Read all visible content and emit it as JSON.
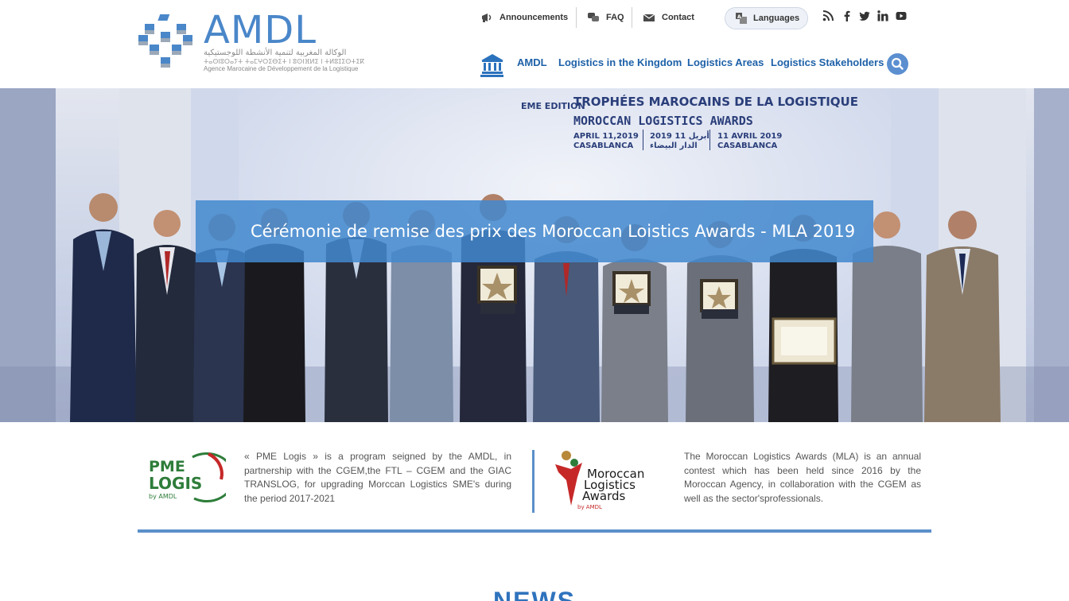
{
  "logo": {
    "text": "AMDL",
    "arabic": "الوكالة المغربية لتنمية الأنشطة اللوجستيكية",
    "tifinagh": "ⵜⴰⵙⵏⵓⵔⴰⵢⵜ ⵜⴰⵎⵖⵔⵉⴱⵉⵜ ⵏ ⵓⵙⵏⴼⵍⵉ ⵏ ⵜⵍⵓⵊⵉⵙⵜⵉⴽ",
    "french": "Agence Marocaine de Développement de la Logistique"
  },
  "util": {
    "announcements": "Announcements",
    "faq": "FAQ",
    "contact": "Contact",
    "languages": "Languages"
  },
  "social": [
    "rss-icon",
    "facebook-icon",
    "twitter-icon",
    "linkedin-icon",
    "youtube-icon"
  ],
  "nav": {
    "items": [
      "AMDL",
      "Logistics in the Kingdom",
      "Logistics Areas",
      "Logistics Stakeholders"
    ]
  },
  "hero": {
    "caption": "Cérémonie de remise des prix des Moroccan Loistics Awards - MLA 2019",
    "banner_edition": "EME EDITION",
    "banner_line1": "TROPHÉES MAROCAINS DE LA LOGISTIQUE",
    "banner_line2": "MOROCCAN LOGISTICS AWARDS",
    "banner_date_left": "APRIL 11,2019",
    "banner_city_left": "CASABLANCA",
    "banner_date_mid": "2019 11 أبريل",
    "banner_city_mid": "الدار البيضاء",
    "banner_date_right": "11 AVRIL 2019",
    "banner_city_right": "CASABLANCA"
  },
  "programs": {
    "pme": {
      "logo_line1": "PME",
      "logo_line2": "LOGIS",
      "logo_by": "by AMDL",
      "text": "« PME Logis » is a program seigned by the AMDL, in partnership with the CGEM,the FTL – CGEM and the GIAC TRANSLOG, for upgrading Morccan Logistics SME's during the period 2017-2021"
    },
    "mla": {
      "logo_line1": "Moroccan",
      "logo_line2": "Logistics",
      "logo_line3": "Awards",
      "logo_by": "by AMDL",
      "text": "The Moroccan Logistics Awards (MLA) is an annual contest which has been held since 2016 by the Moroccan Agency, in collaboration with the CGEM as well as the sector'sprofessionals."
    }
  },
  "news": {
    "title": "NEWS"
  },
  "colors": {
    "brand_blue": "#2b72bd",
    "nav_blue": "#1e61a8",
    "caption_bg": "#4288ce",
    "pme_green": "#2e7d3a",
    "mla_red": "#c62828"
  }
}
